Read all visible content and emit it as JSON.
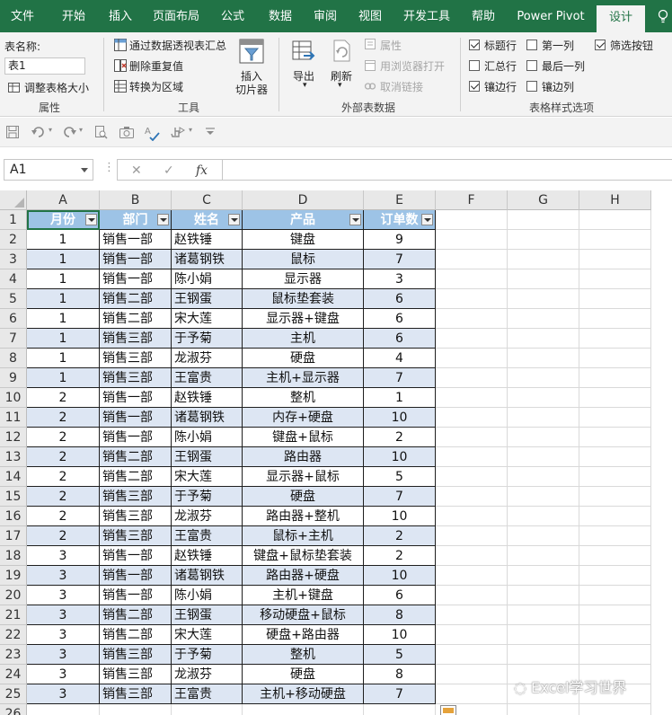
{
  "ribbon_tabs": [
    "文件",
    "开始",
    "插入",
    "页面布局",
    "公式",
    "数据",
    "审阅",
    "视图",
    "开发工具",
    "帮助",
    "Power Pivot",
    "设计"
  ],
  "active_tab": "设计",
  "ribbon": {
    "properties": {
      "table_name_label": "表名称:",
      "table_name_value": "表1",
      "resize_label": "调整表格大小",
      "group_label": "属性"
    },
    "tools": {
      "pivot_label": "通过数据透视表汇总",
      "remove_dup_label": "删除重复值",
      "convert_label": "转换为区域",
      "slicer_label_1": "插入",
      "slicer_label_2": "切片器",
      "group_label": "工具"
    },
    "external": {
      "export_label": "导出",
      "refresh_label": "刷新",
      "properties_label": "属性",
      "browser_label": "用浏览器打开",
      "unlink_label": "取消链接",
      "group_label": "外部表数据"
    },
    "style_options": {
      "header_row": {
        "label": "标题行",
        "checked": true
      },
      "total_row": {
        "label": "汇总行",
        "checked": false
      },
      "banded_rows": {
        "label": "镶边行",
        "checked": true
      },
      "first_column": {
        "label": "第一列",
        "checked": false
      },
      "last_column": {
        "label": "最后一列",
        "checked": false
      },
      "banded_columns": {
        "label": "镶边列",
        "checked": false
      },
      "filter_button": {
        "label": "筛选按钮",
        "checked": true
      },
      "group_label": "表格样式选项"
    }
  },
  "formula_bar": {
    "name_box": "A1",
    "cancel_symbol": "✕",
    "enter_symbol": "✓",
    "fx_symbol": "fx",
    "formula": ""
  },
  "sheet": {
    "column_letters": [
      "A",
      "B",
      "C",
      "D",
      "E",
      "F",
      "G",
      "H"
    ],
    "row_numbers": [
      "1",
      "2",
      "3",
      "4",
      "5",
      "6",
      "7",
      "8",
      "9",
      "10",
      "11",
      "12",
      "13",
      "14",
      "15",
      "16",
      "17",
      "18",
      "19",
      "20",
      "21",
      "22",
      "23",
      "24",
      "25",
      "26"
    ],
    "table_headers": [
      "月份",
      "部门",
      "姓名",
      "产品",
      "订单数"
    ],
    "table_rows": [
      [
        "1",
        "销售一部",
        "赵铁锤",
        "键盘",
        "9"
      ],
      [
        "1",
        "销售一部",
        "诸葛钢铁",
        "鼠标",
        "7"
      ],
      [
        "1",
        "销售一部",
        "陈小娟",
        "显示器",
        "3"
      ],
      [
        "1",
        "销售二部",
        "王钢蛋",
        "鼠标垫套装",
        "6"
      ],
      [
        "1",
        "销售二部",
        "宋大莲",
        "显示器+键盘",
        "6"
      ],
      [
        "1",
        "销售三部",
        "于予菊",
        "主机",
        "6"
      ],
      [
        "1",
        "销售三部",
        "龙淑芬",
        "硬盘",
        "4"
      ],
      [
        "1",
        "销售三部",
        "王富贵",
        "主机+显示器",
        "7"
      ],
      [
        "2",
        "销售一部",
        "赵铁锤",
        "整机",
        "1"
      ],
      [
        "2",
        "销售一部",
        "诸葛钢铁",
        "内存+硬盘",
        "10"
      ],
      [
        "2",
        "销售一部",
        "陈小娟",
        "键盘+鼠标",
        "2"
      ],
      [
        "2",
        "销售二部",
        "王钢蛋",
        "路由器",
        "10"
      ],
      [
        "2",
        "销售二部",
        "宋大莲",
        "显示器+鼠标",
        "5"
      ],
      [
        "2",
        "销售三部",
        "于予菊",
        "硬盘",
        "7"
      ],
      [
        "2",
        "销售三部",
        "龙淑芬",
        "路由器+整机",
        "10"
      ],
      [
        "2",
        "销售三部",
        "王富贵",
        "鼠标+主机",
        "2"
      ],
      [
        "3",
        "销售一部",
        "赵铁锤",
        "键盘+鼠标垫套装",
        "2"
      ],
      [
        "3",
        "销售一部",
        "诸葛钢铁",
        "路由器+硬盘",
        "10"
      ],
      [
        "3",
        "销售一部",
        "陈小娟",
        "主机+键盘",
        "6"
      ],
      [
        "3",
        "销售二部",
        "王钢蛋",
        "移动硬盘+鼠标",
        "8"
      ],
      [
        "3",
        "销售二部",
        "宋大莲",
        "硬盘+路由器",
        "10"
      ],
      [
        "3",
        "销售三部",
        "于予菊",
        "整机",
        "5"
      ],
      [
        "3",
        "销售三部",
        "龙淑芬",
        "硬盘",
        "8"
      ],
      [
        "3",
        "销售三部",
        "王富贵",
        "主机+移动硬盘",
        "7"
      ]
    ]
  },
  "watermark": "Excel学习世界",
  "colors": {
    "ribbon_green": "#217346",
    "table_header": "#9dc3e6",
    "table_band": "#dde6f3"
  }
}
